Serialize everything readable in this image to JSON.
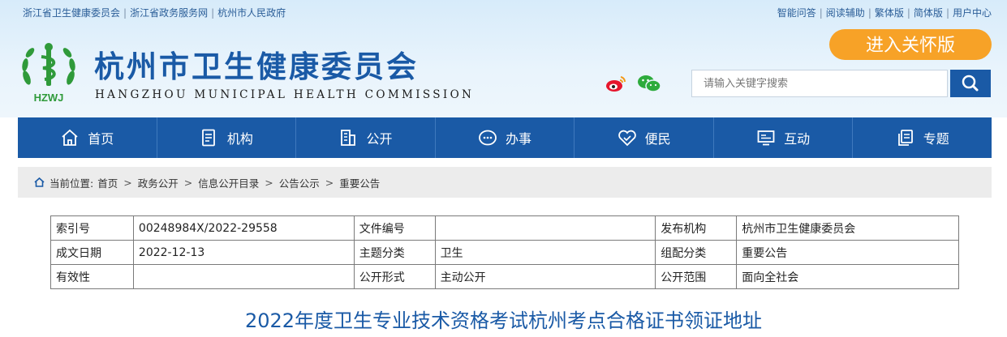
{
  "top_links_left": [
    "浙江省卫生健康委员会",
    "浙江省政务服务网",
    "杭州市人民政府"
  ],
  "top_links_right": [
    "智能问答",
    "阅读辅助",
    "繁体版",
    "简体版",
    "用户中心"
  ],
  "header": {
    "logo_text": "HZWJ",
    "title": "杭州市卫生健康委员会",
    "subtitle": "HANGZHOU MUNICIPAL HEALTH COMMISSION",
    "care_button": "进入关怀版"
  },
  "search": {
    "placeholder": "请输入关键字搜索"
  },
  "nav": [
    {
      "label": "首页",
      "icon": "home-icon"
    },
    {
      "label": "机构",
      "icon": "document-icon"
    },
    {
      "label": "公开",
      "icon": "building-icon"
    },
    {
      "label": "办事",
      "icon": "chat-icon"
    },
    {
      "label": "便民",
      "icon": "handshake-icon"
    },
    {
      "label": "互动",
      "icon": "monitor-icon"
    },
    {
      "label": "专题",
      "icon": "copy-icon"
    }
  ],
  "breadcrumb": {
    "prefix": "当前位置:",
    "items": [
      "首页",
      "政务公开",
      "信息公开目录",
      "公告公示",
      "重要公告"
    ]
  },
  "meta_table": [
    [
      "索引号",
      "00248984X/2022-29558",
      "文件编号",
      "",
      "发布机构",
      "杭州市卫生健康委员会"
    ],
    [
      "成文日期",
      "2022-12-13",
      "主题分类",
      "卫生",
      "组配分类",
      "重要公告"
    ],
    [
      "有效性",
      "",
      "公开形式",
      "主动公开",
      "公开范围",
      "面向全社会"
    ]
  ],
  "article": {
    "title": "2022年度卫生专业技术资格考试杭州考点合格证书领证地址"
  },
  "colors": {
    "brand_blue": "#1a5aa6",
    "care_orange": "#f7a227"
  }
}
